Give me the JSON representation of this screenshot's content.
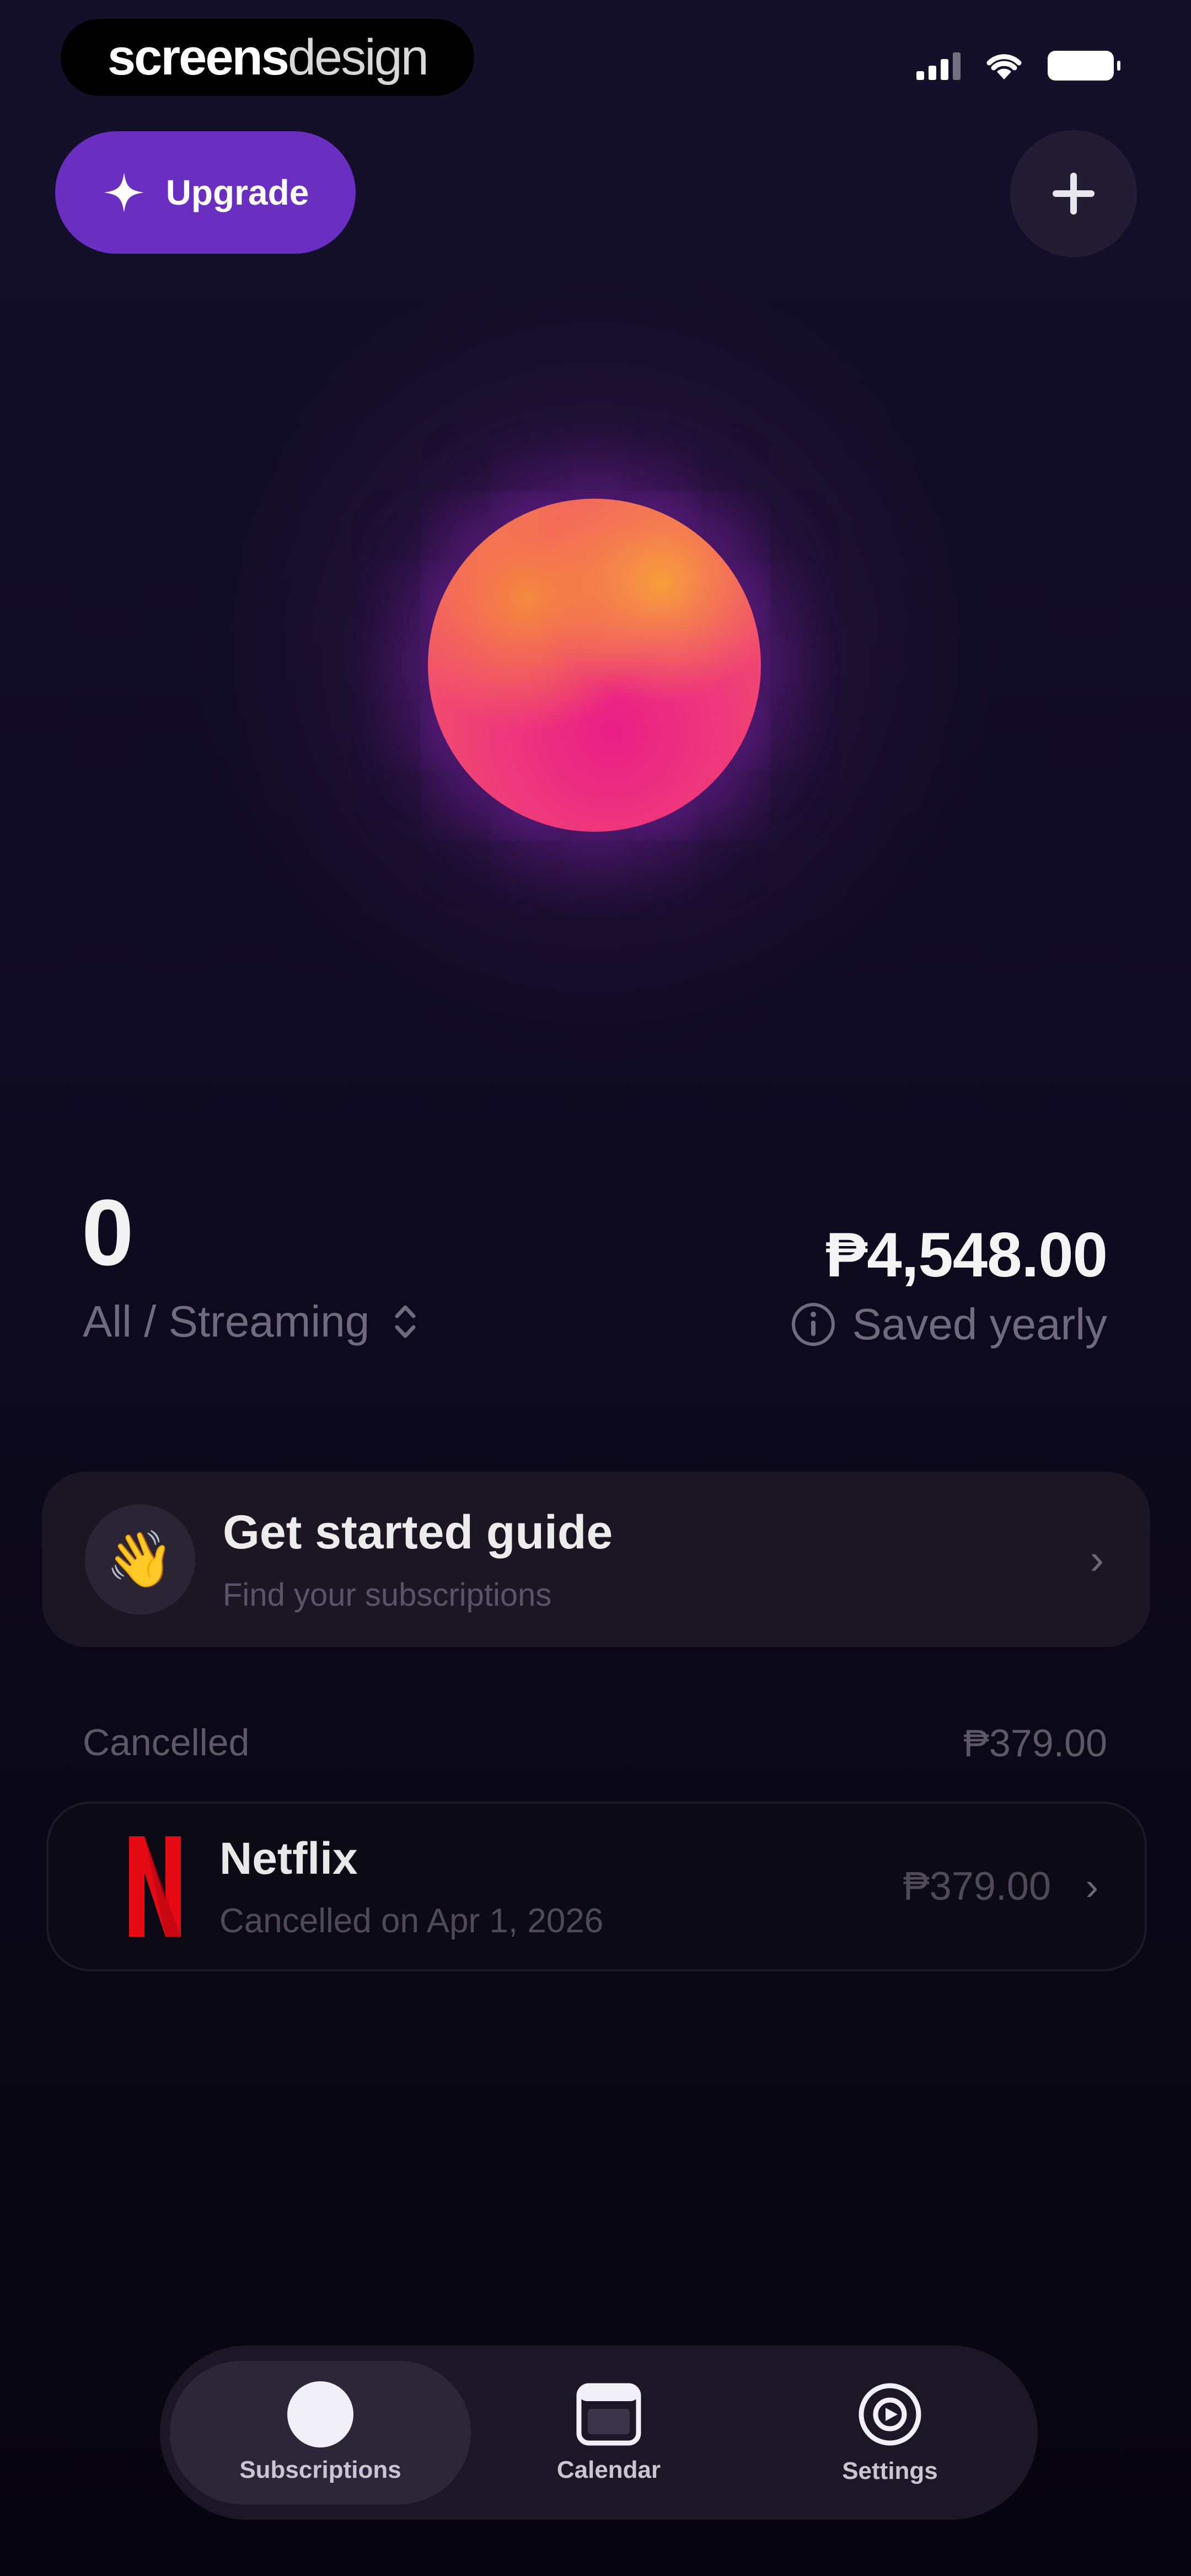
{
  "status_bar": {
    "brand": {
      "bold": "screens",
      "light": "design"
    }
  },
  "header": {
    "upgrade_label": "Upgrade",
    "add_icon": "plus-icon",
    "upgrade_icon": "sparkle-icon"
  },
  "hero": {
    "orb_colors": [
      "#f7a03a",
      "#ea1f86",
      "#f2536b"
    ]
  },
  "stats": {
    "count": "0",
    "filter_label": "All / Streaming",
    "amount": "₱4,548.00",
    "amount_caption": "Saved yearly"
  },
  "guide": {
    "title": "Get started guide",
    "subtitle": "Find your subscriptions",
    "icon": "waving-hand-icon"
  },
  "cancelled": {
    "label": "Cancelled",
    "total": "₱379.00",
    "items": [
      {
        "name": "Netflix",
        "status": "Cancelled on Apr 1, 2026",
        "price": "₱379.00",
        "logo": "netflix-logo"
      }
    ]
  },
  "tabs": [
    {
      "label": "Subscriptions",
      "icon": "circle-icon",
      "active": true
    },
    {
      "label": "Calendar",
      "icon": "calendar-icon",
      "active": false
    },
    {
      "label": "Settings",
      "icon": "settings-icon",
      "active": false
    }
  ],
  "colors": {
    "accent": "#6a2ec0",
    "background": "#0b0818",
    "netflix_red": "#e50914"
  }
}
